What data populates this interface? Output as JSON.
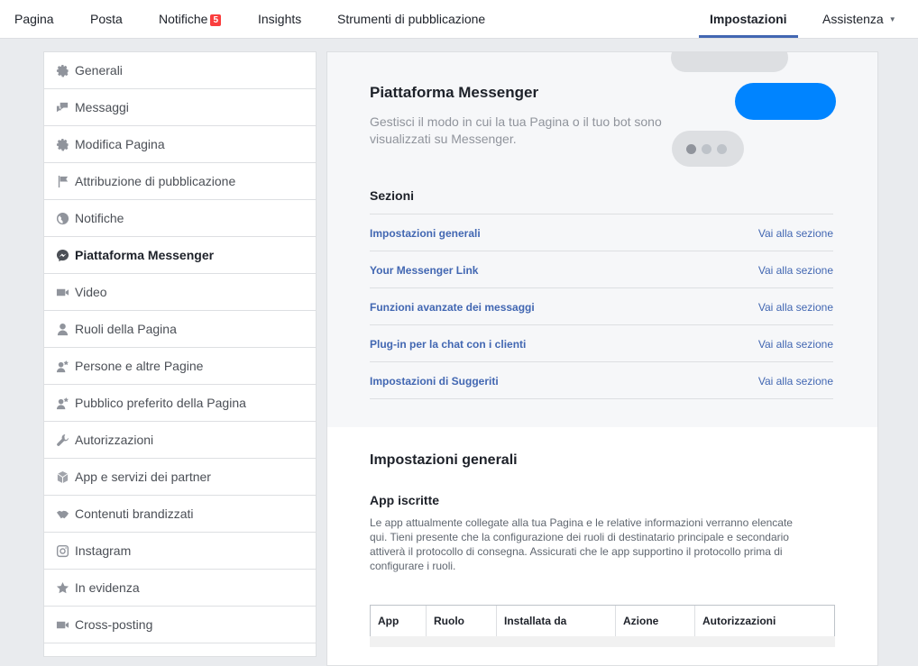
{
  "topnav": {
    "tabs": [
      {
        "label": "Pagina"
      },
      {
        "label": "Posta"
      },
      {
        "label": "Notifiche",
        "badge": "5"
      },
      {
        "label": "Insights"
      },
      {
        "label": "Strumenti di pubblicazione"
      }
    ],
    "settings_tab": "Impostazioni",
    "help_tab": "Assistenza"
  },
  "sidebar": {
    "items": [
      {
        "label": "Generali",
        "icon": "gear-icon"
      },
      {
        "label": "Messaggi",
        "icon": "chat-bubbles-icon"
      },
      {
        "label": "Modifica Pagina",
        "icon": "gear-icon"
      },
      {
        "label": "Attribuzione di pubblicazione",
        "icon": "flag-icon"
      },
      {
        "label": "Notifiche",
        "icon": "globe-icon"
      },
      {
        "label": "Piattaforma Messenger",
        "icon": "messenger-icon",
        "active": true
      },
      {
        "label": "Video",
        "icon": "video-camera-icon"
      },
      {
        "label": "Ruoli della Pagina",
        "icon": "person-icon"
      },
      {
        "label": "Persone e altre Pagine",
        "icon": "person-star-icon"
      },
      {
        "label": "Pubblico preferito della Pagina",
        "icon": "person-star-icon"
      },
      {
        "label": "Autorizzazioni",
        "icon": "wrench-icon"
      },
      {
        "label": "App e servizi dei partner",
        "icon": "cube-icon"
      },
      {
        "label": "Contenuti brandizzati",
        "icon": "handshake-icon"
      },
      {
        "label": "Instagram",
        "icon": "instagram-icon"
      },
      {
        "label": "In evidenza",
        "icon": "star-icon"
      },
      {
        "label": "Cross-posting",
        "icon": "video-camera-icon"
      }
    ]
  },
  "hero": {
    "title": "Piattaforma Messenger",
    "description": "Gestisci il modo in cui la tua Pagina o il tuo bot sono visualizzati su Messenger."
  },
  "sections": {
    "title": "Sezioni",
    "link_label": "Vai alla sezione",
    "items": [
      {
        "name": "Impostazioni generali"
      },
      {
        "name": "Your Messenger Link"
      },
      {
        "name": "Funzioni avanzate dei messaggi"
      },
      {
        "name": "Plug-in per la chat con i clienti"
      },
      {
        "name": "Impostazioni di Suggeriti"
      }
    ]
  },
  "general_settings": {
    "title": "Impostazioni generali",
    "apps_title": "App iscritte",
    "apps_description": "Le app attualmente collegate alla tua Pagina e le relative informazioni verranno elencate qui. Tieni presente che la configurazione dei ruoli di destinatario principale e secondario attiverà il protocollo di consegna. Assicurati che le app supportino il protocollo prima di configurare i ruoli.",
    "table_headers": [
      "App",
      "Ruolo",
      "Installata da",
      "Azione",
      "Autorizzazioni"
    ]
  },
  "colors": {
    "accent": "#4267b2",
    "messenger_blue": "#0084ff",
    "badge_red": "#fa3e3e"
  }
}
